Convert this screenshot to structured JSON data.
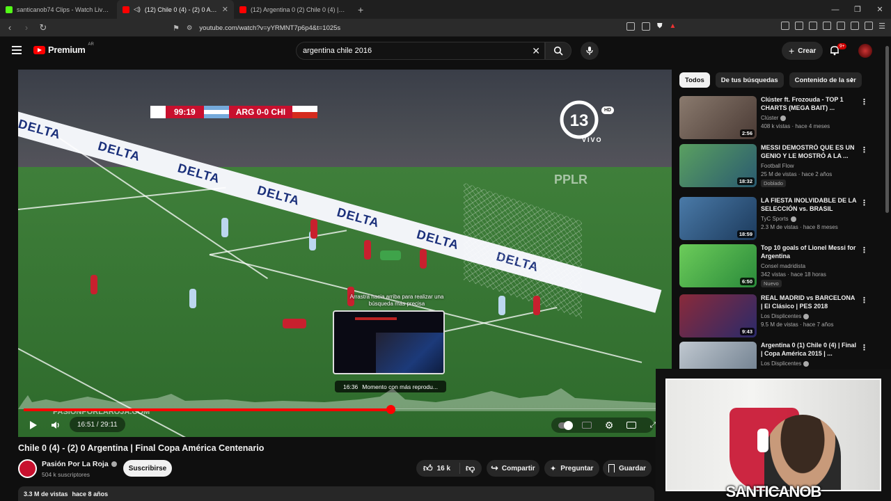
{
  "browser": {
    "tabs": [
      {
        "title": "santicanob74 Clips - Watch Live on K",
        "color": "#53fc18"
      },
      {
        "title": "(12) Chile 0 (4) - (2) 0 Argentina",
        "color": "#ff0000"
      },
      {
        "title": "(12) Argentina 0 (2) Chile 0 (4) | Final",
        "color": "#ff0000"
      }
    ],
    "url": "youtube.com/watch?v=yYRMNT7p6p4&t=1025s"
  },
  "header": {
    "logo_text": "Premium",
    "country": "AR",
    "search_value": "argentina chile 2016",
    "create_label": "Crear",
    "notif_count": "9+"
  },
  "player": {
    "scoreboard": {
      "time": "99:19",
      "team1": "ARG",
      "score": "0-0",
      "team2": "CHI"
    },
    "channel_logo": "13",
    "channel_tag": "HD",
    "live_label": "VIVO",
    "watermark": "PASIONPORLAROJA.COM",
    "board_text": "DELTA",
    "broadcaster": "PPLR",
    "hint": "Arrastra hacia arriba para realizar una búsqueda más precisa",
    "chapter_time": "16:36",
    "chapter_label": "Momento con más reprodu...",
    "current_time": "16:51",
    "duration": "29:11",
    "progress": 0.578
  },
  "video": {
    "title": "Chile 0 (4) - (2) 0 Argentina | Final Copa América Centenario",
    "channel": "Pasión Por La Roja",
    "subscribers": "504 k suscriptores",
    "subscribe_label": "Suscribirse",
    "likes": "16 k",
    "share_label": "Compartir",
    "ask_label": "Preguntar",
    "save_label": "Guardar",
    "views": "3.3 M de vistas",
    "age": "hace 8 años"
  },
  "sidebar": {
    "chips": [
      "Todos",
      "De tus búsquedas",
      "Contenido de la ser"
    ],
    "recommendations": [
      {
        "title": "Clúster ft. Frozouda - TOP 1 CHARTS (MEGA BAIT) ...",
        "channel": "Clúster",
        "meta": "408 k vistas · hace 4 meses",
        "duration": "2:56",
        "tag": "",
        "thumb": "#6b5a50"
      },
      {
        "title": "MESSI DEMOSTRÓ QUE ES UN GENIO Y LE MOSTRÓ A LA ...",
        "channel": "Football Flow",
        "meta": "25 M de vistas · hace 2 años",
        "duration": "18:32",
        "tag": "Doblado",
        "thumb": "#3c8a4a"
      },
      {
        "title": "LA FIESTA INOLVIDABLE DE LA SELECCIÓN vs. BRASIL",
        "channel": "TyC Sports",
        "meta": "2.3 M de vistas · hace 8 meses",
        "duration": "18:59",
        "tag": "",
        "thumb": "#3a5f8c"
      },
      {
        "title": "Top 10 goals of Lionel Messi for Argentina",
        "channel": "Consel madridista",
        "meta": "342 vistas · hace 18 horas",
        "duration": "6:50",
        "tag": "Nuevo",
        "thumb": "#4bb04a"
      },
      {
        "title": "REAL MADRID vs BARCELONA | El Clásico | PES 2018",
        "channel": "Los Displicentes",
        "meta": "9.5 M de vistas · hace 7 años",
        "duration": "9:43",
        "tag": "",
        "thumb": "#6a2a3a"
      },
      {
        "title": "Argentina 0 (1) Chile 0 (4) | Final | Copa América 2015 | ...",
        "channel": "Los Displicentes",
        "meta": "",
        "duration": "",
        "tag": "",
        "thumb": "#8a9aaa"
      }
    ]
  },
  "webcam": {
    "name": "SANTICANOB"
  }
}
